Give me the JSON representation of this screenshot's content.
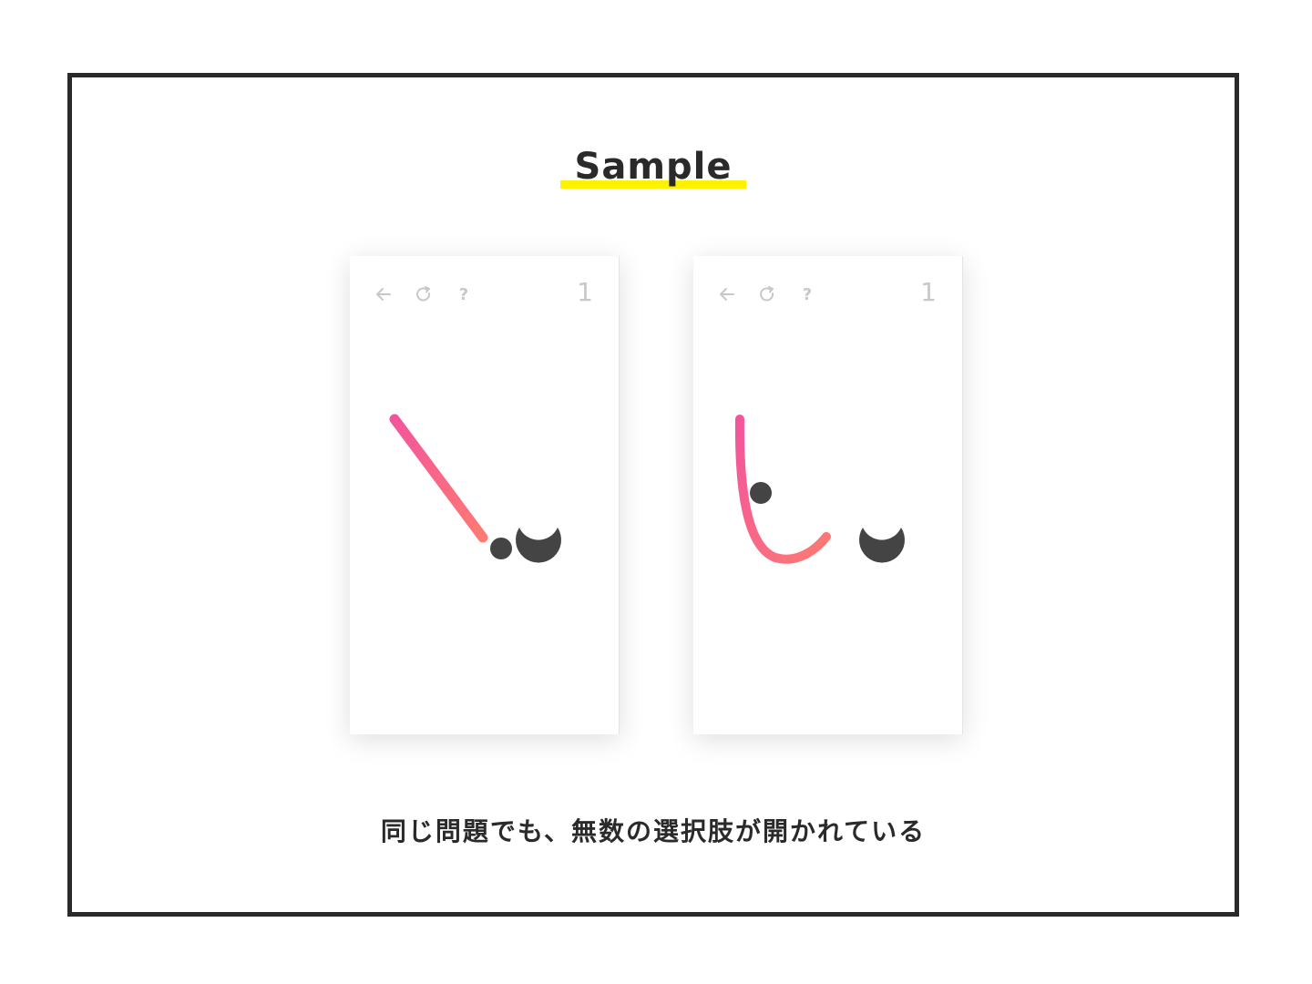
{
  "title": "Sample",
  "caption": "同じ問題でも、無数の選択肢が開かれている",
  "colors": {
    "border": "#2a2a2a",
    "highlight": "#fff200",
    "toolbar_icon": "#c8c8c8",
    "stroke_start": "#f2559c",
    "stroke_end": "#fe7a72",
    "ball": "#444444"
  },
  "phones": [
    {
      "toolbar": {
        "back_icon": "arrow-left-icon",
        "restart_icon": "restart-icon",
        "help_icon": "help-icon",
        "help_label": "?"
      },
      "level": "1"
    },
    {
      "toolbar": {
        "back_icon": "arrow-left-icon",
        "restart_icon": "restart-icon",
        "help_icon": "help-icon",
        "help_label": "?"
      },
      "level": "1"
    }
  ]
}
